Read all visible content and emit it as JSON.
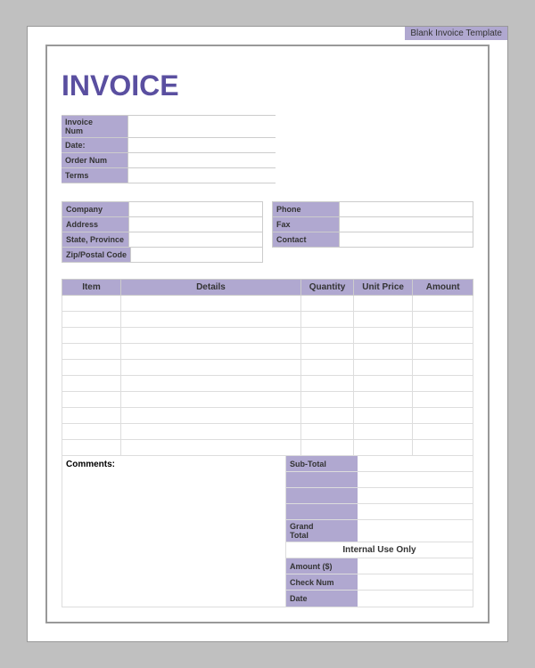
{
  "template": {
    "label": "Blank Invoice Template"
  },
  "invoice": {
    "title": "INVOICE"
  },
  "top_fields": [
    {
      "label": "Invoice\nNum",
      "value": ""
    },
    {
      "label": "Date:",
      "value": ""
    },
    {
      "label": "Order Num",
      "value": ""
    },
    {
      "label": "Terms",
      "value": ""
    }
  ],
  "address_fields": [
    {
      "label": "Company",
      "value": ""
    },
    {
      "label": "Address",
      "value": ""
    },
    {
      "label": "State, Province",
      "value": ""
    },
    {
      "label": "Zip/Postal Code",
      "value": ""
    }
  ],
  "contact_fields": [
    {
      "label": "Phone",
      "value": ""
    },
    {
      "label": "Fax",
      "value": ""
    },
    {
      "label": "Contact",
      "value": ""
    }
  ],
  "table": {
    "headers": [
      "Item",
      "Details",
      "Quantity",
      "Unit Price",
      "Amount"
    ],
    "rows": 10
  },
  "comments_label": "Comments:",
  "totals": {
    "sub_total_label": "Sub-Total",
    "grand_total_label": "Grand\nTotal",
    "empty_rows": 3
  },
  "internal_use": {
    "label": "Internal Use Only",
    "fields": [
      {
        "label": "Amount ($)",
        "value": ""
      },
      {
        "label": "Check Num",
        "value": ""
      },
      {
        "label": "Date",
        "value": ""
      }
    ]
  },
  "colors": {
    "accent": "#b0a8d0",
    "title": "#5a4fa0"
  }
}
